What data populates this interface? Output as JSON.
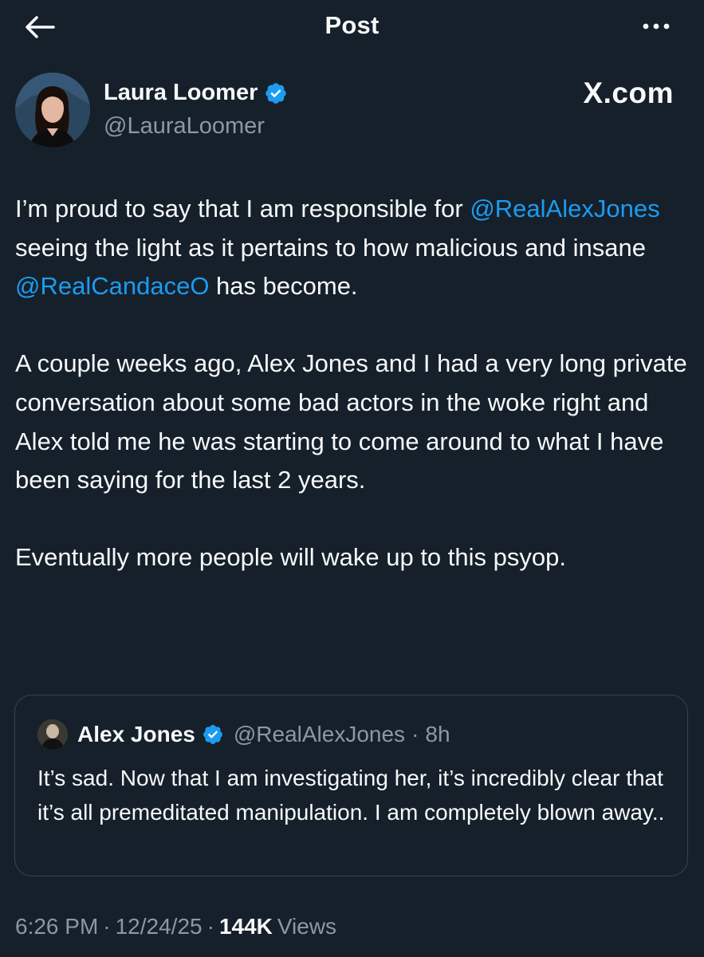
{
  "header": {
    "title": "Post",
    "back_icon": "arrow-left-icon",
    "more_icon": "more-horizontal-icon"
  },
  "author": {
    "name": "Laura Loomer",
    "handle": "@LauraLoomer",
    "verified": true
  },
  "watermark": "X.com",
  "post": {
    "p1_a": "I’m proud to say that I am responsible for ",
    "p1_mention1": "@RealAlexJones",
    "p1_b": " seeing the light as it pertains to how malicious and insane ",
    "p1_mention2": "@RealCandaceO",
    "p1_c": " has become.",
    "p2": "A couple weeks ago, Alex Jones and I had a very long private conversation about some bad actors in the woke right and Alex told me he was starting to come around to what I have been saying for the last 2 years.",
    "p3": "Eventually more people will wake up to this psyop."
  },
  "quote": {
    "name": "Alex Jones",
    "handle": "@RealAlexJones",
    "separator": "·",
    "time": "8h",
    "text": "It’s sad. Now that I am investigating her, it’s incredibly clear that it’s all premeditated manipulation. I am completely blown away.."
  },
  "meta": {
    "time": "6:26 PM",
    "sep1": "·",
    "date": "12/24/25",
    "sep2": "·",
    "views_count": "144K",
    "views_label": "Views"
  },
  "colors": {
    "background": "#15202b",
    "text": "#f7f9f9",
    "secondary": "#8b98a5",
    "accent": "#1d9bf0",
    "border": "#38444d"
  }
}
